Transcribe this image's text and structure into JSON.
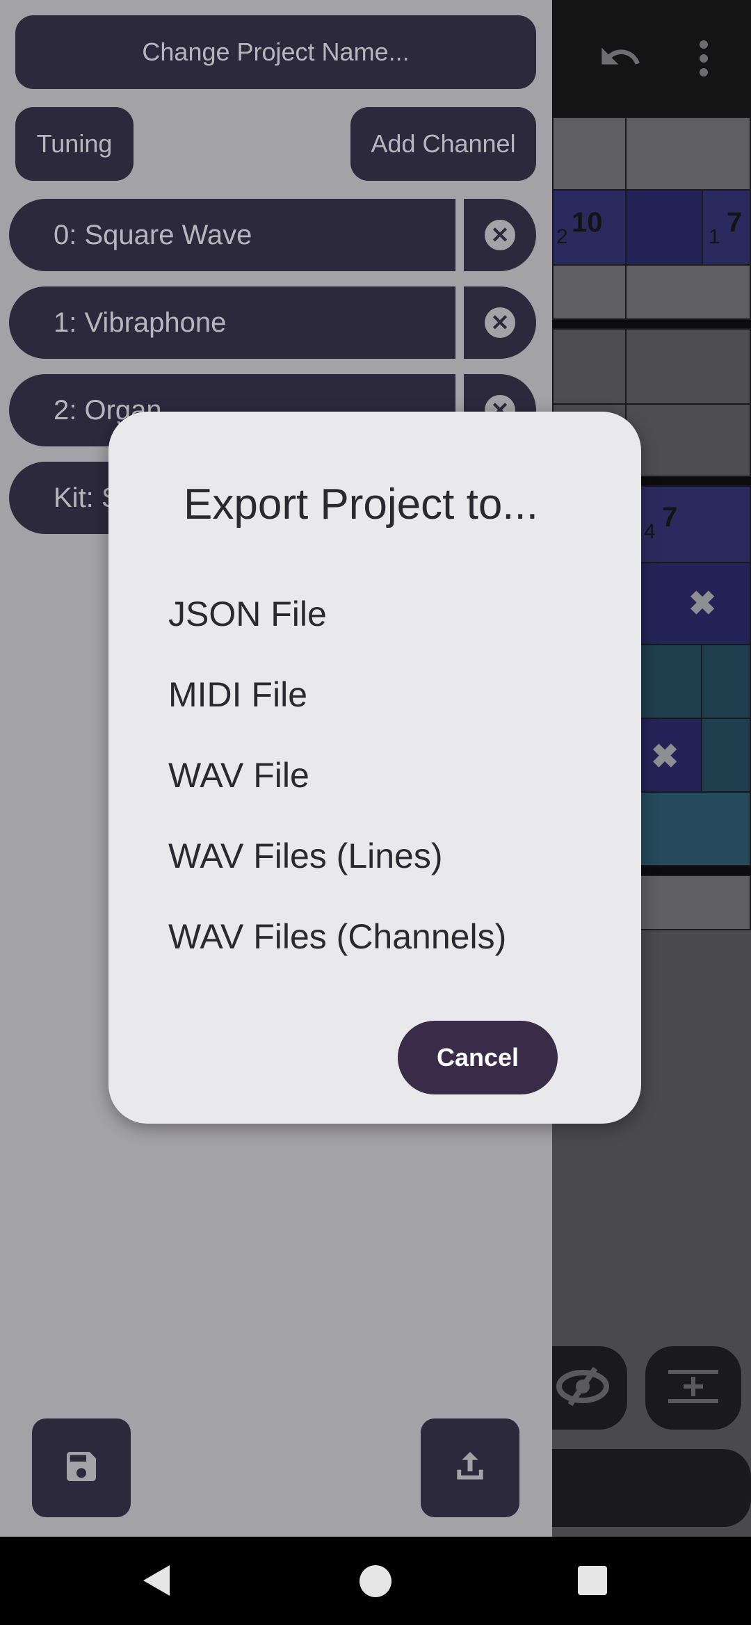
{
  "drawer": {
    "change_name_label": "Change Project Name...",
    "tuning_label": "Tuning",
    "add_channel_label": "Add Channel",
    "channels": [
      {
        "label": "0: Square Wave"
      },
      {
        "label": "1: Vibraphone"
      },
      {
        "label": "2: Organ"
      },
      {
        "label": "Kit: S"
      }
    ],
    "save_icon": "save-icon",
    "export_icon": "share-upload-icon"
  },
  "background": {
    "undo_icon": "undo-icon",
    "more_icon": "more-vert-icon",
    "cells": {
      "c1_sub": "2",
      "c1_num": "10",
      "c2_sub": "1",
      "c2_num": "7",
      "c3_sub": "4",
      "c3_num": "7"
    },
    "visibility_icon": "visibility-off-icon",
    "insert_icon": "insert-line-icon"
  },
  "dialog": {
    "title": "Export Project to...",
    "options": [
      {
        "label": "JSON File"
      },
      {
        "label": "MIDI File"
      },
      {
        "label": "WAV File"
      },
      {
        "label": "WAV Files (Lines)"
      },
      {
        "label": "WAV Files (Channels)"
      }
    ],
    "cancel_label": "Cancel"
  },
  "navbar": {
    "back_icon": "back-icon",
    "home_icon": "home-icon",
    "recents_icon": "recents-icon"
  },
  "colors": {
    "button_bg": "#2d293d",
    "dialog_bg": "#e9e8eb",
    "cancel_bg": "#3a2b48"
  }
}
